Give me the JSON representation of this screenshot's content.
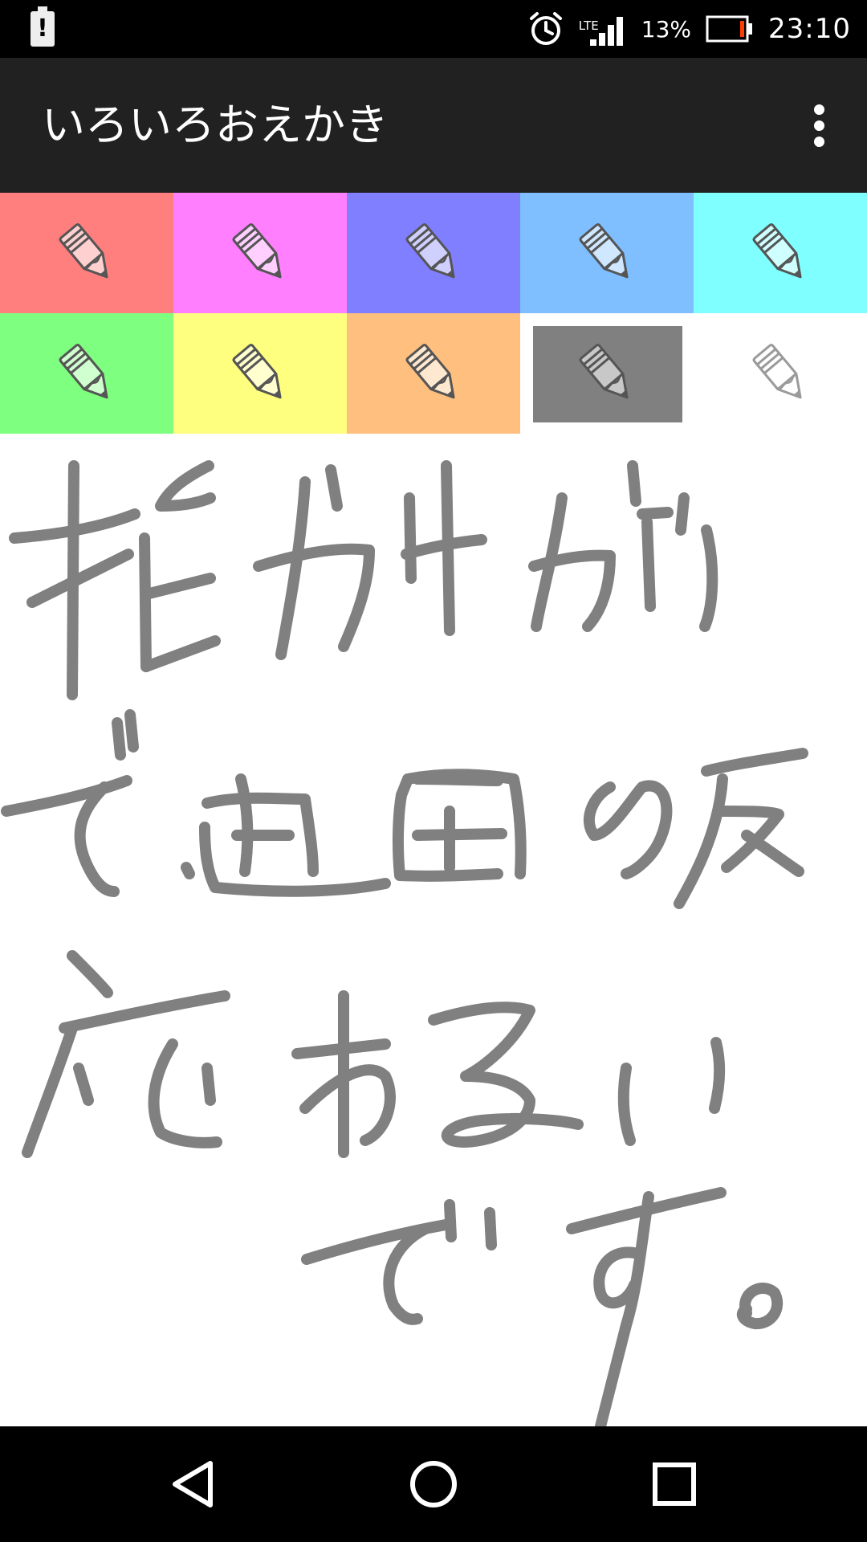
{
  "status_bar": {
    "network_label": "LTE",
    "battery_percent": "13%",
    "time": "23:10",
    "icons": [
      "alert-icon",
      "alarm-icon",
      "signal-icon",
      "battery-icon"
    ]
  },
  "app_bar": {
    "title": "いろいろおえかき",
    "menu_icon": "more-vertical-icon"
  },
  "palette": {
    "selected_index": 8,
    "colors": [
      {
        "name": "red",
        "bg": "#ff7f7f",
        "pencil_fill": "#ffd0d0"
      },
      {
        "name": "magenta",
        "bg": "#ff7fff",
        "pencil_fill": "#ffd0ff"
      },
      {
        "name": "blue",
        "bg": "#7f7fff",
        "pencil_fill": "#d0d0ff"
      },
      {
        "name": "sky",
        "bg": "#7fbfff",
        "pencil_fill": "#d0e8ff"
      },
      {
        "name": "cyan",
        "bg": "#7fffff",
        "pencil_fill": "#d0ffff"
      },
      {
        "name": "green",
        "bg": "#7fff7f",
        "pencil_fill": "#d0ffd0"
      },
      {
        "name": "yellow",
        "bg": "#ffff7f",
        "pencil_fill": "#ffffd0"
      },
      {
        "name": "orange",
        "bg": "#ffbf7f",
        "pencil_fill": "#ffe8d0"
      },
      {
        "name": "gray",
        "bg": "#808080",
        "pencil_fill": "#c8c8c8"
      },
      {
        "name": "white",
        "bg": "#ffffff",
        "pencil_fill": "#ffffff"
      }
    ]
  },
  "canvas": {
    "stroke_color": "#808080",
    "handwriting_lines": [
      "指がサガサ",
      "で画画の反",
      "応わるい",
      "です。"
    ]
  },
  "nav_bar": {
    "icons": [
      "back-icon",
      "home-icon",
      "recents-icon"
    ]
  }
}
